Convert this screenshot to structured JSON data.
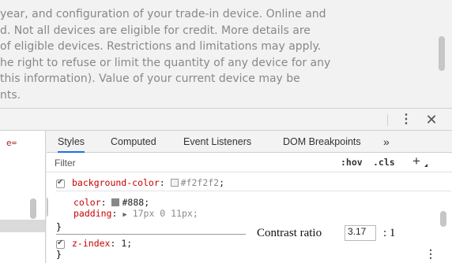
{
  "page": {
    "lines": [
      "year, and configuration of your trade-in device. Online and",
      "d. Not all devices are eligible for credit. More details are",
      "of eligible devices. Restrictions and limitations may apply.",
      "he right to refuse or limit the quantity of any device for any",
      "this information). Value of your current device may be",
      "nts."
    ]
  },
  "devtools": {
    "left_fragment": "e=",
    "tabs": [
      "Styles",
      "Computed",
      "Event Listeners",
      "DOM Breakpoints",
      "»"
    ],
    "filter_placeholder": "Filter",
    "hov_label": ":hov",
    "cls_label": ".cls",
    "add_rule_label": "+",
    "rule": {
      "bg_name": "background-color",
      "bg_value": "#f2f2f2",
      "color_name": "color",
      "color_value": "#888",
      "padding_name": "padding",
      "padding_value": "17px 0 11px",
      "close_brace": "}",
      "zindex_name": "z-index",
      "zindex_value": "1"
    },
    "contrast": {
      "label": "Contrast ratio",
      "value": "3.17",
      "suffix": ": 1"
    },
    "colors": {
      "swatch_bg": "#f2f2f2",
      "swatch_color": "#888888",
      "tab_active_underline": "#1a73e8",
      "property_name": "#c80000"
    },
    "icons": [
      "more-vert-icon",
      "close-icon",
      "chevron-double-right-icon",
      "add-rule-icon",
      "rule-menu-icon"
    ]
  }
}
